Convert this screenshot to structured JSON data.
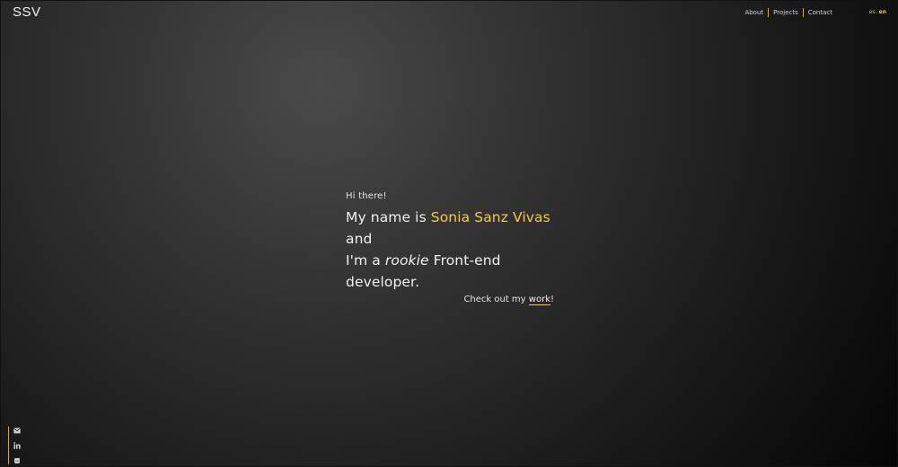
{
  "header": {
    "logo": "SSV",
    "nav": [
      {
        "label": "About"
      },
      {
        "label": "Projects"
      },
      {
        "label": "Contact"
      }
    ],
    "lang": {
      "es": "es",
      "separator": ".",
      "en": "en",
      "active": "en"
    }
  },
  "hero": {
    "greeting": "Hi there!",
    "line1_prefix": "My name is ",
    "name": "Sonia Sanz Vivas",
    "line1_suffix": " and",
    "line2_prefix": "I'm a ",
    "line2_italic": "rookie",
    "line2_suffix": " Front-end developer.",
    "cta_prefix": "Check out my ",
    "cta_link": "work",
    "cta_suffix": "!"
  },
  "social": [
    {
      "icon": "mail-icon"
    },
    {
      "icon": "linkedin-icon"
    },
    {
      "icon": "github-icon"
    }
  ],
  "colors": {
    "accent": "#f2c94c",
    "separator": "#e0a63a",
    "text": "#f0f0f0"
  }
}
